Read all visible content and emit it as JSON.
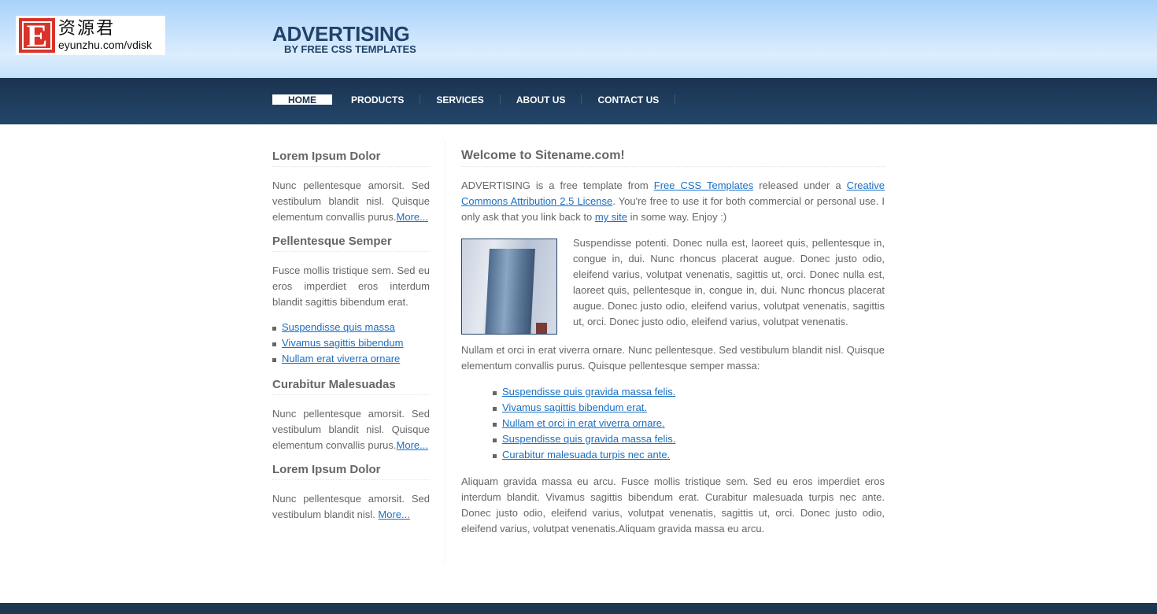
{
  "logo": {
    "cn": "资源君",
    "url": "eyunzhu.com/vdisk",
    "letter": "E"
  },
  "header": {
    "title": "ADVERTISING",
    "subtitle": "BY FREE CSS TEMPLATES"
  },
  "nav": [
    "HOME",
    "PRODUCTS",
    "SERVICES",
    "ABOUT US",
    "CONTACT US"
  ],
  "sidebar": {
    "s1": {
      "title": "Lorem Ipsum Dolor",
      "text": "Nunc pellentesque amorsit. Sed vestibulum blandit nisl. Quisque elementum convallis purus.",
      "more": "More..."
    },
    "s2": {
      "title": "Pellentesque Semper",
      "text": "Fusce mollis tristique sem. Sed eu eros imperdiet eros interdum blandit sagittis bibendum erat.",
      "links": [
        "Suspendisse quis massa",
        "Vivamus sagittis bibendum",
        "Nullam erat viverra ornare"
      ]
    },
    "s3": {
      "title": "Curabitur Malesuadas",
      "text": "Nunc pellentesque amorsit. Sed vestibulum blandit nisl. Quisque elementum convallis purus.",
      "more": "More..."
    },
    "s4": {
      "title": "Lorem Ipsum Dolor",
      "text": "Nunc pellentesque amorsit. Sed vestibulum blandit nisl. ",
      "more": "More..."
    }
  },
  "main": {
    "title": "Welcome to Sitename.com!",
    "intro": {
      "t1": "ADVERTISING is a free template from ",
      "l1": "Free CSS Templates",
      "t2": " released under a ",
      "l2": "Creative Commons Attribution 2.5 License",
      "t3": ". You're free to use it for both commercial or personal use. I only ask that you link back to ",
      "l3": "my site",
      "t4": " in some way. Enjoy :)"
    },
    "p2": "Suspendisse potenti. Donec nulla est, laoreet quis, pellentesque in, congue in, dui. Nunc rhoncus placerat augue. Donec justo odio, eleifend varius, volutpat venenatis, sagittis ut, orci. Donec nulla est, laoreet quis, pellentesque in, congue in, dui. Nunc rhoncus placerat augue. Donec justo odio, eleifend varius, volutpat venenatis, sagittis ut, orci. Donec justo odio, eleifend varius, volutpat venenatis.",
    "p3": "Nullam et orci in erat viverra ornare. Nunc pellentesque. Sed vestibulum blandit nisl. Quisque elementum convallis purus. Quisque pellentesque semper massa:",
    "links": [
      "Suspendisse quis gravida massa felis.",
      "Vivamus sagittis bibendum erat.",
      "Nullam et orci in erat viverra ornare.",
      "Suspendisse quis gravida massa felis.",
      "Curabitur malesuada turpis nec ante."
    ],
    "p4": "Aliquam gravida massa eu arcu. Fusce mollis tristique sem. Sed eu eros imperdiet eros interdum blandit. Vivamus sagittis bibendum erat. Curabitur malesuada turpis nec ante. Donec justo odio, eleifend varius, volutpat venenatis, sagittis ut, orci. Donec justo odio, eleifend varius, volutpat venenatis.Aliquam gravida massa eu arcu."
  },
  "colors": {
    "nav": "#1c3350",
    "link": "#1a6fc4",
    "text": "#666666"
  }
}
